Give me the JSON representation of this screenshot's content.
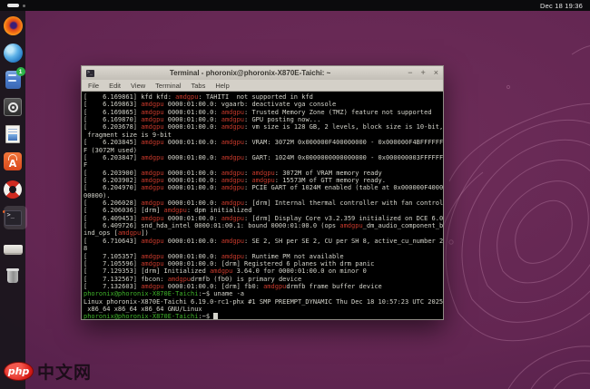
{
  "top_bar": {
    "clock": "Dec 18 19:36"
  },
  "dock": {
    "items": [
      "firefox",
      "thunderbird",
      "files",
      "rhythmbox",
      "libreoffice-writer",
      "app-center",
      "help",
      "terminal",
      "removable-drive",
      "trash"
    ],
    "files_badge": "1"
  },
  "window": {
    "title": "Terminal - phoronix@phoronix-X870E-Taichi: ~",
    "menus": [
      "File",
      "Edit",
      "View",
      "Terminal",
      "Tabs",
      "Help"
    ],
    "controls": {
      "minimize": "−",
      "maximize": "+",
      "close": "×"
    },
    "title_icon_glyph": ">_"
  },
  "terminal": {
    "colors": {
      "f": "#d4d4cb",
      "r": "#c8392b",
      "g": "#3fb42a",
      "bg": "#000000"
    },
    "lines": [
      [
        {
          "t": "[    6.169861] kfd kfd: ",
          "c": "f"
        },
        {
          "t": "amdgpu",
          "c": "r"
        },
        {
          "t": ": TAHITI  not supported in kfd",
          "c": "f"
        }
      ],
      [
        {
          "t": "[    6.169863] ",
          "c": "f"
        },
        {
          "t": "amdgpu",
          "c": "r"
        },
        {
          "t": " 0000:01:00.0: vgaarb: deactivate vga console",
          "c": "f"
        }
      ],
      [
        {
          "t": "[    6.169865] ",
          "c": "f"
        },
        {
          "t": "amdgpu",
          "c": "r"
        },
        {
          "t": " 0000:01:00.0: ",
          "c": "f"
        },
        {
          "t": "amdgpu",
          "c": "r"
        },
        {
          "t": ": Trusted Memory Zone (TMZ) feature not supported",
          "c": "f"
        }
      ],
      [
        {
          "t": "[    6.169870] ",
          "c": "f"
        },
        {
          "t": "amdgpu",
          "c": "r"
        },
        {
          "t": " 0000:01:00.0: ",
          "c": "f"
        },
        {
          "t": "amdgpu",
          "c": "r"
        },
        {
          "t": ": GPU posting now...",
          "c": "f"
        }
      ],
      [
        {
          "t": "[    6.203678] ",
          "c": "f"
        },
        {
          "t": "amdgpu",
          "c": "r"
        },
        {
          "t": " 0000:01:00.0: ",
          "c": "f"
        },
        {
          "t": "amdgpu",
          "c": "r"
        },
        {
          "t": ": vm size is 128 GB, 2 levels, block size is 10-bit,",
          "c": "f"
        }
      ],
      [
        {
          "t": " fragment size is 9-bit",
          "c": "f"
        }
      ],
      [
        {
          "t": "[    6.203845] ",
          "c": "f"
        },
        {
          "t": "amdgpu",
          "c": "r"
        },
        {
          "t": " 0000:01:00.0: ",
          "c": "f"
        },
        {
          "t": "amdgpu",
          "c": "r"
        },
        {
          "t": ": VRAM: 3072M 0x000000F400000000 - 0x000000F4BFFFFFF",
          "c": "f"
        }
      ],
      [
        {
          "t": "F (3072M used)",
          "c": "f"
        }
      ],
      [
        {
          "t": "[    6.203847] ",
          "c": "f"
        },
        {
          "t": "amdgpu",
          "c": "r"
        },
        {
          "t": " 0000:01:00.0: ",
          "c": "f"
        },
        {
          "t": "amdgpu",
          "c": "r"
        },
        {
          "t": ": GART: 1024M 0x0000000000000000 - 0x000000003FFFFFF",
          "c": "f"
        }
      ],
      [
        {
          "t": "F",
          "c": "f"
        }
      ],
      [
        {
          "t": "[    6.203900] ",
          "c": "f"
        },
        {
          "t": "amdgpu",
          "c": "r"
        },
        {
          "t": " 0000:01:00.0: ",
          "c": "f"
        },
        {
          "t": "amdgpu",
          "c": "r"
        },
        {
          "t": ": ",
          "c": "f"
        },
        {
          "t": "amdgpu",
          "c": "r"
        },
        {
          "t": ": 3072M of VRAM memory ready",
          "c": "f"
        }
      ],
      [
        {
          "t": "[    6.203902] ",
          "c": "f"
        },
        {
          "t": "amdgpu",
          "c": "r"
        },
        {
          "t": " 0000:01:00.0: ",
          "c": "f"
        },
        {
          "t": "amdgpu",
          "c": "r"
        },
        {
          "t": ": ",
          "c": "f"
        },
        {
          "t": "amdgpu",
          "c": "r"
        },
        {
          "t": ": 15573M of GTT memory ready.",
          "c": "f"
        }
      ],
      [
        {
          "t": "[    6.204970] ",
          "c": "f"
        },
        {
          "t": "amdgpu",
          "c": "r"
        },
        {
          "t": " 0000:01:00.0: ",
          "c": "f"
        },
        {
          "t": "amdgpu",
          "c": "r"
        },
        {
          "t": ": PCIE GART of 1024M enabled (table at 0x000000F4000",
          "c": "f"
        }
      ],
      [
        {
          "t": "00000).",
          "c": "f"
        }
      ],
      [
        {
          "t": "[    6.206028] ",
          "c": "f"
        },
        {
          "t": "amdgpu",
          "c": "r"
        },
        {
          "t": " 0000:01:00.0: ",
          "c": "f"
        },
        {
          "t": "amdgpu",
          "c": "r"
        },
        {
          "t": ": [drm] Internal thermal controller with fan control",
          "c": "f"
        }
      ],
      [
        {
          "t": "[    6.206036] [drm] ",
          "c": "f"
        },
        {
          "t": "amdgpu",
          "c": "r"
        },
        {
          "t": ": dpm initialized",
          "c": "f"
        }
      ],
      [
        {
          "t": "[    6.409453] ",
          "c": "f"
        },
        {
          "t": "amdgpu",
          "c": "r"
        },
        {
          "t": " 0000:01:00.0: ",
          "c": "f"
        },
        {
          "t": "amdgpu",
          "c": "r"
        },
        {
          "t": ": [drm] Display Core v3.2.359 initialized on DCE 6.0",
          "c": "f"
        }
      ],
      [
        {
          "t": "[    6.409726] snd_hda_intel 0000:01:00.1: bound 0000:01:00.0 (ops ",
          "c": "f"
        },
        {
          "t": "amdgpu",
          "c": "r"
        },
        {
          "t": "_dm_audio_component_b",
          "c": "f"
        }
      ],
      [
        {
          "t": "ind_ops [",
          "c": "f"
        },
        {
          "t": "amdgpu",
          "c": "r"
        },
        {
          "t": "])",
          "c": "f"
        }
      ],
      [
        {
          "t": "[    6.710643] ",
          "c": "f"
        },
        {
          "t": "amdgpu",
          "c": "r"
        },
        {
          "t": " 0000:01:00.0: ",
          "c": "f"
        },
        {
          "t": "amdgpu",
          "c": "r"
        },
        {
          "t": ": SE 2, SH per SE 2, CU per SH 8, active_cu_number 2",
          "c": "f"
        }
      ],
      [
        {
          "t": "8",
          "c": "f"
        }
      ],
      [
        {
          "t": "[    7.105357] ",
          "c": "f"
        },
        {
          "t": "amdgpu",
          "c": "r"
        },
        {
          "t": " 0000:01:00.0: ",
          "c": "f"
        },
        {
          "t": "amdgpu",
          "c": "r"
        },
        {
          "t": ": Runtime PM not available",
          "c": "f"
        }
      ],
      [
        {
          "t": "[    7.105596] ",
          "c": "f"
        },
        {
          "t": "amdgpu",
          "c": "r"
        },
        {
          "t": " 0000:01:00.0: [drm] Registered 6 planes with drm panic",
          "c": "f"
        }
      ],
      [
        {
          "t": "[    7.129353] [drm] Initialized ",
          "c": "f"
        },
        {
          "t": "amdgpu",
          "c": "r"
        },
        {
          "t": " 3.64.0 for 0000:01:00.0 on minor 0",
          "c": "f"
        }
      ],
      [
        {
          "t": "[    7.132567] fbcon: ",
          "c": "f"
        },
        {
          "t": "amdgpu",
          "c": "r"
        },
        {
          "t": "drmfb (fb0) is primary device",
          "c": "f"
        }
      ],
      [
        {
          "t": "[    7.132603] ",
          "c": "f"
        },
        {
          "t": "amdgpu",
          "c": "r"
        },
        {
          "t": " 0000:01:00.0: [drm] fb0: ",
          "c": "f"
        },
        {
          "t": "amdgpu",
          "c": "r"
        },
        {
          "t": "drmfb frame buffer device",
          "c": "f"
        }
      ],
      [
        {
          "t": "phoronix@phoronix-X870E-Taichi",
          "c": "g"
        },
        {
          "t": ":~$ uname -a",
          "c": "f"
        }
      ],
      [
        {
          "t": "Linux phoronix-X870E-Taichi 6.19.0-rc1-phx #1 SMP PREEMPT_DYNAMIC Thu Dec 18 10:57:23 UTC 2025",
          "c": "f"
        }
      ],
      [
        {
          "t": " x86_64 x86_64 x86_64 GNU/Linux",
          "c": "f"
        }
      ],
      [
        {
          "t": "phoronix@phoronix-X870E-Taichi",
          "c": "g"
        },
        {
          "t": ":~$ ",
          "c": "f"
        },
        {
          "t": " ",
          "c": "cur"
        }
      ]
    ]
  },
  "watermark": {
    "logo": "php",
    "text": "中文网"
  }
}
